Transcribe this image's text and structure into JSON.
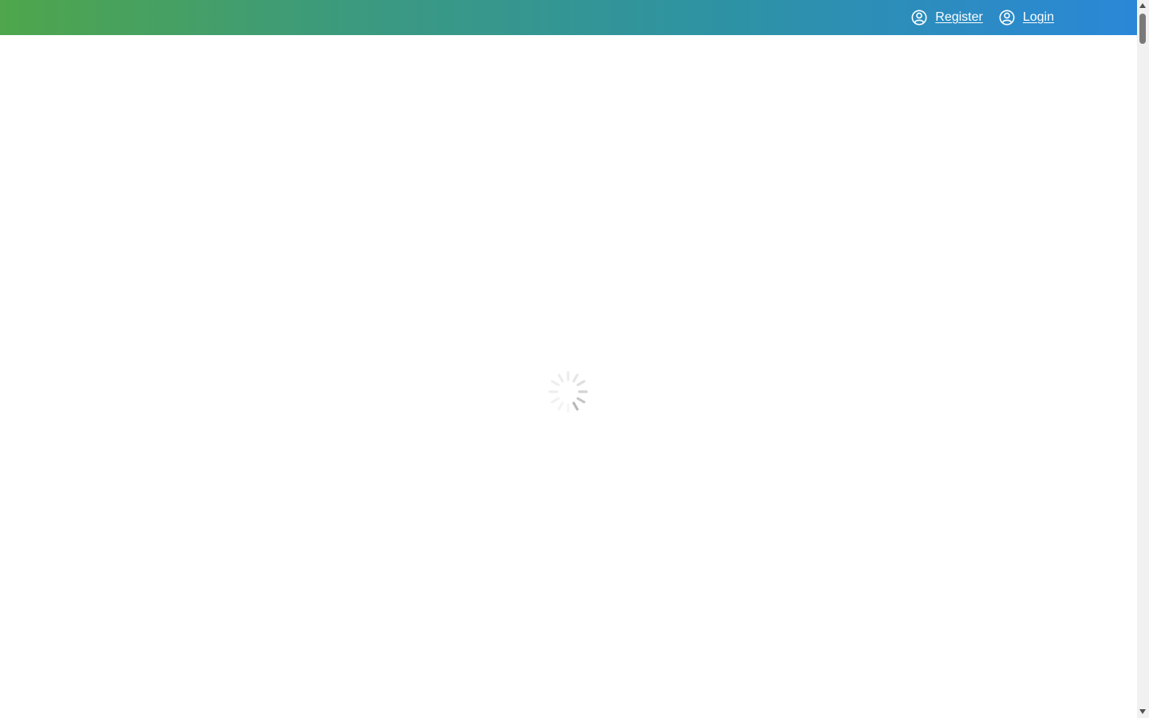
{
  "header": {
    "register_label": "Register",
    "login_label": "Login",
    "gradient_start": "#4fa64b",
    "gradient_end": "#2a87d8"
  },
  "icons": {
    "register": "user-circle-icon",
    "login": "user-circle-icon",
    "loading": "loading-spinner-icon"
  }
}
